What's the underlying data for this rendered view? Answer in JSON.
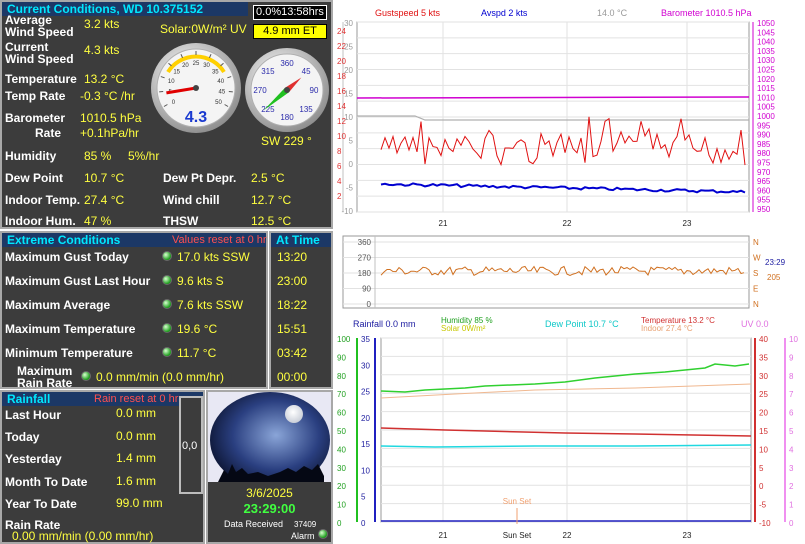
{
  "current": {
    "title": "Current Conditions, WD 10.375152",
    "timer": "0.0%13:58hrs",
    "et": "4.9 mm ET",
    "solar": "Solar:0W/m² UV",
    "avg_wind_label": "Average\nWind Speed",
    "avg_wind": "3.2 kts",
    "cur_wind_label": "Current\nWind Speed",
    "cur_wind": "4.3 kts",
    "temp_label": "Temperature",
    "temp": "13.2 °C",
    "temp_rate_label": "Temp Rate",
    "temp_rate": "-0.3 °C /hr",
    "baro_label": "Barometer",
    "baro": "1010.5 hPa",
    "baro_rate_label": "Rate",
    "baro_rate": "+0.1hPa/hr",
    "humidity_label": "Humidity",
    "humidity": "85 %",
    "humidity_rate": "5%/hr",
    "dew_label": "Dew Point",
    "dew": "10.7 °C",
    "dew_depr_label": "Dew Pt Depr.",
    "dew_depr": "2.5 °C",
    "indoor_temp_label": "Indoor Temp.",
    "indoor_temp": "27.4 °C",
    "windchill_label": "Wind chill",
    "windchill": "12.7 °C",
    "indoor_hum_label": "Indoor Hum.",
    "indoor_hum": "47 %",
    "thsw_label": "THSW",
    "thsw": "12.5 °C",
    "gauge_speed": "4.3",
    "gauge_dir": "SW  229 °",
    "speed_ticks": [
      "0",
      "5",
      "10",
      "15",
      "20",
      "25",
      "30",
      "35",
      "40",
      "45",
      "50"
    ],
    "dir_ticks": [
      "360",
      "45",
      "90",
      "135",
      "180",
      "225",
      "270",
      "315"
    ],
    "wind_speed_kts": 4.3,
    "wind_dir_deg": 229
  },
  "extreme": {
    "title": "Extreme Conditions",
    "reset": "Values reset at 0 hr",
    "at_time": "At Time",
    "rows": [
      {
        "label": "Maximum Gust Today",
        "value": "17.0 kts SSW",
        "time": "13:20"
      },
      {
        "label": "Maximum Gust Last Hour",
        "value": "9.6 kts   S",
        "time": "23:00"
      },
      {
        "label": "Maximum Average",
        "value": "7.6 kts SSW",
        "time": "18:22"
      },
      {
        "label": "Maximum Temperature",
        "value": "19.6 °C",
        "time": "15:51"
      },
      {
        "label": "Minimum Temperature",
        "value": "11.7 °C",
        "time": "03:42"
      },
      {
        "label": "Maximum\nRain Rate",
        "value": "0.0 mm/min (0.0 mm/hr)",
        "time": "00:00"
      }
    ]
  },
  "rain": {
    "title": "Rainfall",
    "reset": "Rain reset at 0 hr",
    "last_hour_label": "Last Hour",
    "last_hour": "0.0 mm",
    "today_label": "Today",
    "today": "0.0 mm",
    "yesterday_label": "Yesterday",
    "yesterday": "1.4 mm",
    "month_label": "Month To Date",
    "month": "1.6 mm",
    "year_label": "Year To Date",
    "year": "99.0 mm",
    "rate_label": "Rain Rate",
    "rate": "0.00 mm/min (0.00 mm/hr)",
    "gauge": "0,0"
  },
  "sky": {
    "date": "3/6/2025",
    "time": "23:29:00",
    "data_received_label": "Data Received",
    "data_received": "37409",
    "alarm": "Alarm"
  },
  "graph1": {
    "legend_gust": "Gustspeed   5 kts",
    "legend_avg": "Avspd   2 kts",
    "legend_temp": "14.0 °C",
    "legend_baro": "Barometer  1010.5 hPa",
    "left_ticks": [
      "24",
      "22",
      "20",
      "18",
      "16",
      "14",
      "12",
      "10",
      "8",
      "6",
      "4",
      "2"
    ],
    "mid_ticks": [
      "30",
      "25",
      "20",
      "15",
      "10",
      "5",
      "0",
      "-5",
      "-10"
    ],
    "right_ticks": [
      "1050",
      "1045",
      "1040",
      "1035",
      "1030",
      "1025",
      "1020",
      "1015",
      "1010",
      "1005",
      "1000",
      "995",
      "990",
      "985",
      "980",
      "975",
      "970",
      "965",
      "960",
      "955",
      "950"
    ],
    "x_ticks": [
      "21",
      "22",
      "23"
    ],
    "gust_color": "#e01010",
    "avg_color": "#0000d0",
    "baro_color": "#d000d0"
  },
  "graph2": {
    "left_ticks": [
      "360",
      "270",
      "180",
      "90",
      "0"
    ],
    "dir_labels": [
      "N",
      "W",
      "S",
      "E",
      "N"
    ],
    "time": "23:29",
    "value": "205",
    "color": "#d07020"
  },
  "graph3": {
    "legend_rain": "Rainfall   0.0 mm",
    "legend_humidity": "Humidity  85 %",
    "legend_solar": "Solar      0W/m²",
    "legend_dew": "Dew Point  10.7 °C",
    "legend_temp": "Temperature   13.2 °C",
    "legend_indoor": "Indoor          27.4 °C",
    "legend_uv": "UV  0.0",
    "hum_ticks": [
      "100",
      "90",
      "80",
      "70",
      "60",
      "50",
      "40",
      "30",
      "20",
      "10",
      "0"
    ],
    "rain_ticks": [
      "35",
      "30",
      "25",
      "20",
      "15",
      "10",
      "5",
      "0"
    ],
    "temp_ticks": [
      "40",
      "35",
      "30",
      "25",
      "20",
      "15",
      "10",
      "5",
      "0",
      "-5",
      "-10"
    ],
    "uv_ticks": [
      "10",
      "9",
      "8",
      "7",
      "6",
      "5",
      "4",
      "3",
      "2",
      "1",
      "0"
    ],
    "x_ticks": [
      "21",
      "Sun Set",
      "22",
      "23"
    ],
    "sunset": "Sun Set"
  }
}
